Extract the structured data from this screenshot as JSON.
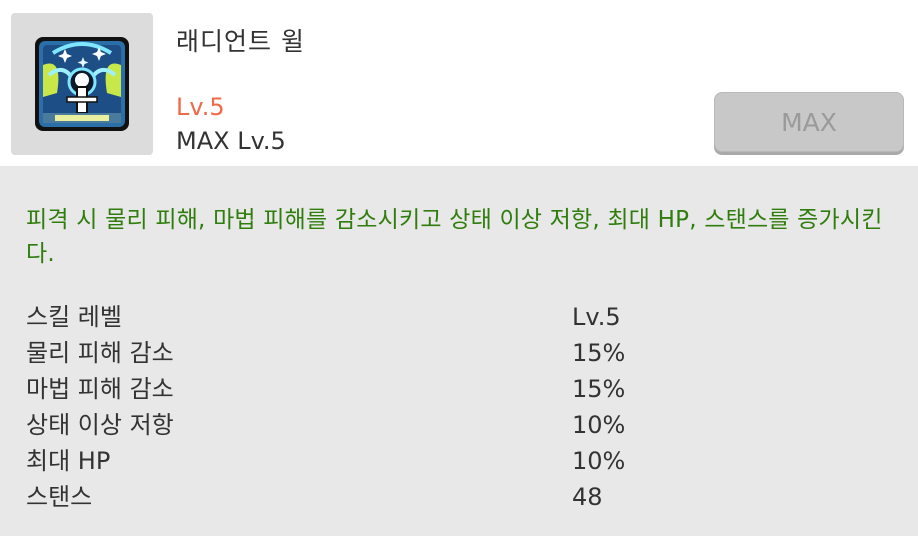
{
  "skill": {
    "name": "래디언트 윌",
    "level": "Lv.5",
    "max_level": "MAX Lv.5",
    "icon": "radiant-will-skill-icon"
  },
  "button": {
    "label": "MAX"
  },
  "description": "피격 시 물리 피해, 마법 피해를 감소시키고 상태 이상 저항, 최대 HP, 스탠스를 증가시킨다.",
  "stats": [
    {
      "label": "스킬 레벨",
      "value": "Lv.5"
    },
    {
      "label": "물리 피해 감소",
      "value": "15%"
    },
    {
      "label": "마법 피해 감소",
      "value": "15%"
    },
    {
      "label": "상태 이상 저항",
      "value": "10%"
    },
    {
      "label": "최대 HP",
      "value": "10%"
    },
    {
      "label": "스탠스",
      "value": "48"
    }
  ],
  "colors": {
    "level": "#ee6a48",
    "description": "#2f7d0c",
    "button_bg": "#c8c8c8"
  }
}
